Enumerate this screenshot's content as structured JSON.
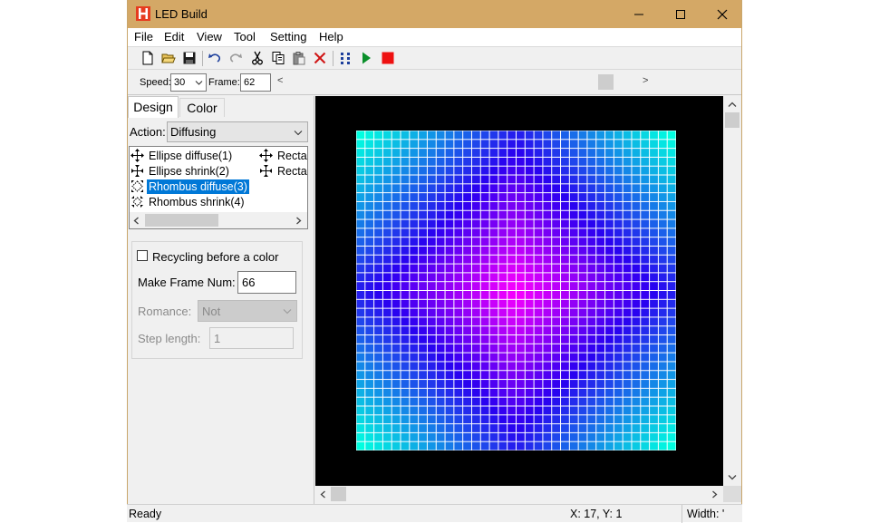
{
  "window": {
    "title": "LED Build",
    "minimize": "—",
    "maximize": "☐",
    "close": "✕"
  },
  "menu": [
    "File",
    "Edit",
    "View",
    "Tool",
    "Setting",
    "Help"
  ],
  "toolbar": {
    "icons": [
      "new-file-icon",
      "open-folder-icon",
      "save-icon",
      "undo-icon",
      "redo-icon",
      "cut-icon",
      "copy-icon",
      "paste-icon",
      "delete-icon",
      "grid-dots-icon",
      "play-icon",
      "stop-icon"
    ]
  },
  "playback": {
    "speed_label": "Speed:",
    "speed_value": "30",
    "frame_label": "Frame:",
    "frame_value": "62",
    "left_arrow": "<",
    "right_arrow": ">"
  },
  "tabs": [
    "Design",
    "Color"
  ],
  "action": {
    "label": "Action:",
    "value": "Diffusing"
  },
  "effects": [
    {
      "label": "Ellipse diffuse(1)",
      "icon": "diffuse-arrows-icon",
      "selected": false
    },
    {
      "label": "Ellipse shrink(2)",
      "icon": "shrink-arrows-icon",
      "selected": false
    },
    {
      "label": "Rhombus diffuse(3)",
      "icon": "rhombus-diffuse-icon",
      "selected": true
    },
    {
      "label": "Rhombus shrink(4)",
      "icon": "rhombus-shrink-icon",
      "selected": false
    }
  ],
  "effects_col2": [
    {
      "label": "Recta",
      "icon": "diffuse-arrows-icon"
    },
    {
      "label": "Recta",
      "icon": "shrink-arrows-icon"
    }
  ],
  "options": {
    "recycling_label": "Recycling before a color",
    "recycling_checked": false,
    "frame_num_label": "Make Frame Num:",
    "frame_num_value": "66",
    "romance_label": "Romance:",
    "romance_value": "Not",
    "step_label": "Step length:",
    "step_value": "1"
  },
  "led_grid": {
    "cols": 36,
    "rows": 36,
    "center_color": "#ff00ff",
    "mid_color": "#2a00f0",
    "edge_color": "#00ffe0"
  },
  "status": {
    "text": "Ready",
    "coords": "X: 17, Y: 1",
    "width": "Width: '"
  }
}
